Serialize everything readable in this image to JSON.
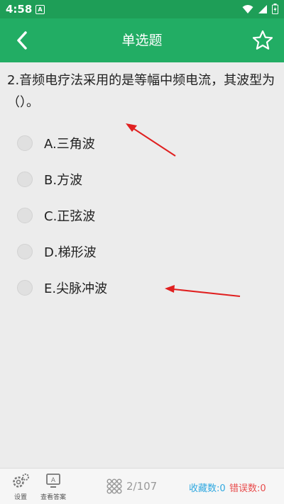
{
  "status_bar": {
    "time": "4:58",
    "notification_letter": "A",
    "icons": [
      "wifi-icon",
      "signal-icon",
      "battery-icon"
    ]
  },
  "app_bar": {
    "title": "单选题",
    "back_icon": "chevron-left-icon",
    "favorite_icon": "star-outline-icon"
  },
  "question": {
    "text": "2.音频电疗法采用的是等幅中频电流，其波型为（）。"
  },
  "options": [
    {
      "label": "A.三角波"
    },
    {
      "label": "B.方波"
    },
    {
      "label": "C.正弦波"
    },
    {
      "label": "D.梯形波"
    },
    {
      "label": "E.尖脉冲波"
    }
  ],
  "bottom_bar": {
    "settings_label": "设置",
    "answer_label": "查看答案",
    "answer_icon_letter": "A",
    "progress": "2/107",
    "favorites": "收藏数:0",
    "errors": "错误数:0"
  },
  "colors": {
    "statusbar": "#1e9e57",
    "appbar": "#22ad64",
    "favorites_text": "#2fa8e0",
    "errors_text": "#e84c4c",
    "annotation_arrow": "#e02020"
  }
}
